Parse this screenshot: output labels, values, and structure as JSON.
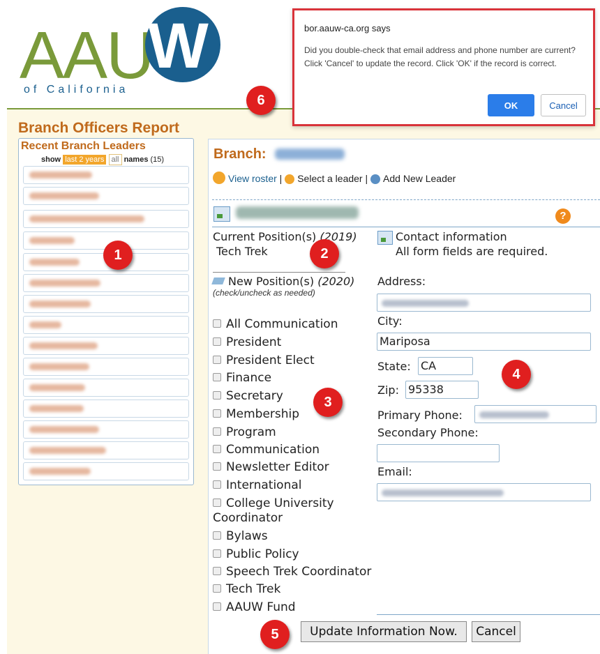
{
  "header": {
    "logo_main": "AAU",
    "logo_w": "W",
    "logo_sub": "of California"
  },
  "left": {
    "report_title": "Branch Officers Report",
    "leaders_title": "Recent Branch Leaders",
    "show_label": "show",
    "filter_active": "last 2 years",
    "filter_all": "all",
    "names_label": "names",
    "names_count": "(15)"
  },
  "branch": {
    "label": "Branch:",
    "view_roster": "View roster",
    "select_leader": "Select a leader",
    "add_leader": "Add New Leader",
    "separator": "|"
  },
  "positions": {
    "current_label": "Current Position(s)",
    "current_year": "(2019)",
    "current_value": "Tech Trek",
    "new_label": "New Position(s)",
    "new_year": "(2020)",
    "new_hint": "(check/uncheck as needed)",
    "items": [
      {
        "label": "All Communication"
      },
      {
        "label": "President"
      },
      {
        "label": "President Elect"
      },
      {
        "label": "Finance"
      },
      {
        "label": "Secretary"
      },
      {
        "label": "Membership"
      },
      {
        "label": "Program"
      },
      {
        "label": "Communication"
      },
      {
        "label": "Newsletter Editor"
      },
      {
        "label": "International"
      },
      {
        "label": "College University"
      },
      {
        "label": "Coordinator"
      },
      {
        "label": "Bylaws"
      },
      {
        "label": "Public Policy"
      },
      {
        "label": "Speech Trek Coordinator"
      },
      {
        "label": "Tech Trek"
      },
      {
        "label": "AAUW Fund"
      }
    ]
  },
  "contact": {
    "title": "Contact information",
    "note": "All form fields are required.",
    "address_label": "Address:",
    "city_label": "City:",
    "city_value": "Mariposa",
    "state_label": "State:",
    "state_value": "CA",
    "zip_label": "Zip:",
    "zip_value": "95338",
    "primary_phone_label": "Primary Phone:",
    "secondary_phone_label": "Secondary Phone:",
    "email_label": "Email:"
  },
  "buttons": {
    "update": "Update Information Now.",
    "cancel": "Cancel"
  },
  "dialog": {
    "origin": "bor.aauw-ca.org says",
    "message": "Did you double-check that email address and phone number are current? Click 'Cancel' to update the record. Click 'OK' if the record is correct.",
    "ok": "OK",
    "cancel": "Cancel"
  },
  "markers": {
    "m1": "1",
    "m2": "2",
    "m3": "3",
    "m4": "4",
    "m5": "5",
    "m6": "6"
  },
  "colors": {
    "accent_orange": "#c06a1c",
    "filter_orange": "#f2a62c",
    "logo_green": "#7a9a3a",
    "logo_blue": "#1a5f8e",
    "marker_red": "#e01f1f",
    "dialog_border": "#d9333a",
    "ok_blue": "#2b7de9"
  }
}
